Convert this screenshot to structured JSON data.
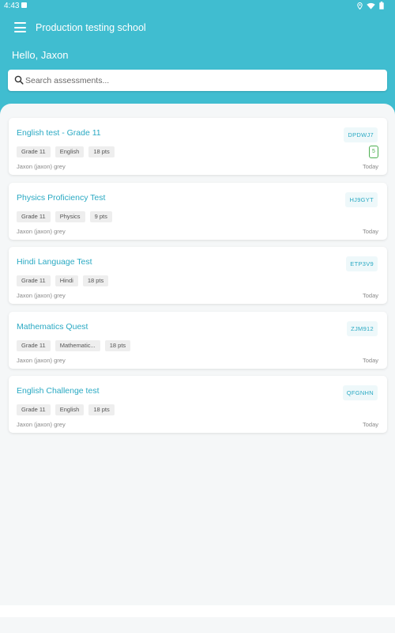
{
  "status_bar": {
    "time": "4:43"
  },
  "toolbar": {
    "title": "Production testing school",
    "greeting": "Hello, Jaxon"
  },
  "search": {
    "placeholder": "Search assessments..."
  },
  "colors": {
    "header": "#40bdd0",
    "accent": "#2aa9c3",
    "badge": "#4caf50"
  },
  "assessments": [
    {
      "title": "English test - Grade 11",
      "code": "DPDWJ7",
      "grade": "Grade 11",
      "subject": "English",
      "points": "18 pts",
      "badge": "5",
      "author": "Jaxon (jaxon) grey",
      "date": "Today"
    },
    {
      "title": "Physics Proficiency Test",
      "code": "HJ9GYT",
      "grade": "Grade 11",
      "subject": "Physics",
      "points": "9 pts",
      "author": "Jaxon (jaxon) grey",
      "date": "Today"
    },
    {
      "title": "Hindi Language Test",
      "code": "ETP3V9",
      "grade": "Grade 11",
      "subject": "Hindi",
      "points": "18 pts",
      "author": "Jaxon (jaxon) grey",
      "date": "Today"
    },
    {
      "title": "Mathematics Quest",
      "code": "ZJM912",
      "grade": "Grade 11",
      "subject": "Mathematic...",
      "points": "18 pts",
      "author": "Jaxon (jaxon) grey",
      "date": "Today"
    },
    {
      "title": "English Challenge test",
      "code": "QFGNHN",
      "grade": "Grade 11",
      "subject": "English",
      "points": "18 pts",
      "author": "Jaxon (jaxon) grey",
      "date": "Today"
    }
  ]
}
